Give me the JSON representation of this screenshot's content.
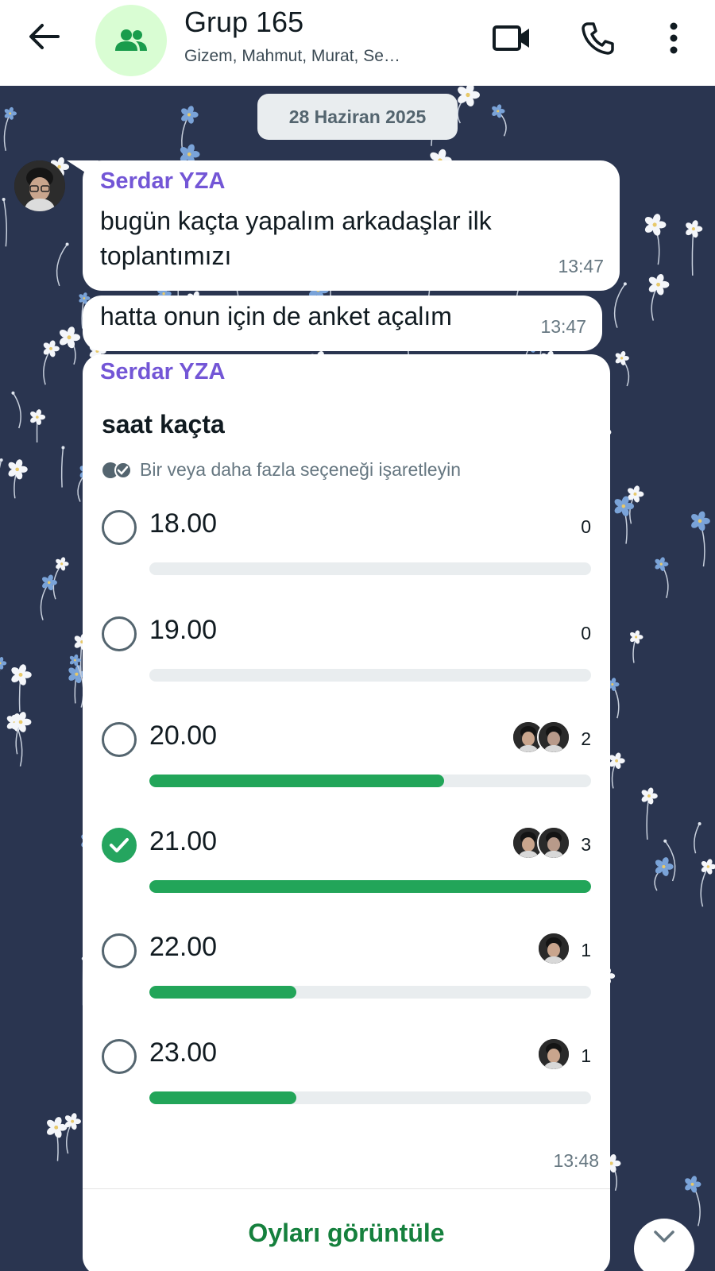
{
  "header": {
    "title": "Grup 165",
    "subtitle": "Gizem, Mahmut, Murat, Se…",
    "icons": [
      "back-arrow-icon",
      "group-icon",
      "video-camera-icon",
      "phone-icon",
      "more-vert-icon"
    ]
  },
  "chat": {
    "date_label": "28 Haziran 2025",
    "messages": [
      {
        "sender": "Serdar YZA",
        "line1": "bugün kaçta yapalım arkadaşlar ilk",
        "line2": "toplantımızı",
        "time": "13:47"
      },
      {
        "text": "hatta onun için de anket açalım",
        "time": "13:47"
      }
    ],
    "poll": {
      "sender": "Serdar YZA",
      "question": "saat kaçta",
      "hint": "Bir veya daha fazla seçeneği işaretleyin",
      "options": [
        {
          "label": "18.00",
          "votes": "0",
          "fill": 0,
          "checked": false,
          "voter_count": 0
        },
        {
          "label": "19.00",
          "votes": "0",
          "fill": 0,
          "checked": false,
          "voter_count": 0
        },
        {
          "label": "20.00",
          "votes": "2",
          "fill": 0.6667,
          "checked": false,
          "voter_count": 2
        },
        {
          "label": "21.00",
          "votes": "3",
          "fill": 1.0,
          "checked": true,
          "voter_count": 2
        },
        {
          "label": "22.00",
          "votes": "1",
          "fill": 0.3333,
          "checked": false,
          "voter_count": 1
        },
        {
          "label": "23.00",
          "votes": "1",
          "fill": 0.3333,
          "checked": false,
          "voter_count": 1
        }
      ],
      "time": "13:48",
      "view_votes_label": "Oyları görüntüle"
    }
  },
  "colors": {
    "accent_green": "#22a559",
    "sender_purple": "#7356d6",
    "chat_background": "#2a3550"
  }
}
